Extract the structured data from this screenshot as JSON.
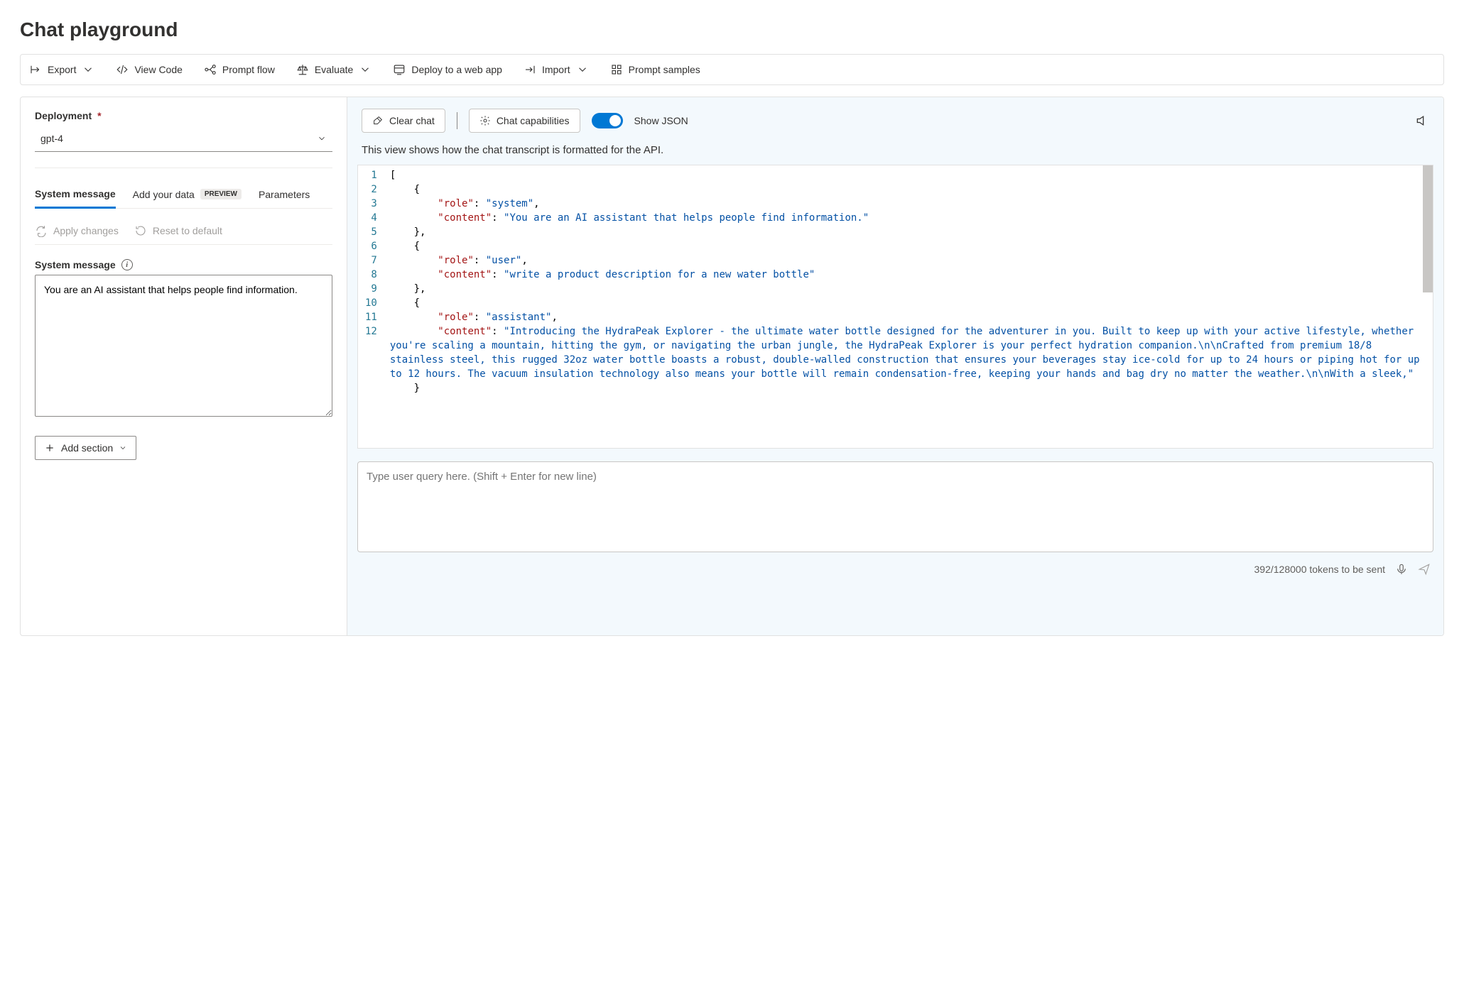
{
  "page_title": "Chat playground",
  "toolbar": {
    "export": "Export",
    "view_code": "View Code",
    "prompt_flow": "Prompt flow",
    "evaluate": "Evaluate",
    "deploy": "Deploy to a web app",
    "import": "Import",
    "samples": "Prompt samples"
  },
  "left": {
    "deployment_label": "Deployment",
    "deployment_value": "gpt-4",
    "tabs": {
      "system_message": "System message",
      "add_data": "Add your data",
      "add_data_badge": "PREVIEW",
      "parameters": "Parameters"
    },
    "apply_changes": "Apply changes",
    "reset_default": "Reset to default",
    "system_message_label": "System message",
    "system_message_value": "You are an AI assistant that helps people find information.",
    "add_section": "Add section"
  },
  "right_top": {
    "clear_chat": "Clear chat",
    "capabilities": "Chat capabilities",
    "show_json": "Show JSON"
  },
  "description": "This view shows how the chat transcript is formatted for the API.",
  "code_lines": [
    "1",
    "2",
    "3",
    "4",
    "5",
    "6",
    "7",
    "8",
    "9",
    "10",
    "11",
    "12"
  ],
  "json_transcript": [
    {
      "role": "system",
      "content": "You are an AI assistant that helps people find information."
    },
    {
      "role": "user",
      "content": "write a product description for a new water bottle"
    },
    {
      "role": "assistant",
      "content": "Introducing the HydraPeak Explorer - the ultimate water bottle designed for the adventurer in you. Built to keep up with your active lifestyle, whether you're scaling a mountain, hitting the gym, or navigating the urban jungle, the HydraPeak Explorer is your perfect hydration companion.\\n\\nCrafted from premium 18/8 stainless steel, this rugged 32oz water bottle boasts a robust, double-walled construction that ensures your beverages stay ice-cold for up to 24 hours or piping hot for up to 12 hours. The vacuum insulation technology also means your bottle will remain condensation-free, keeping your hands and bag dry no matter the weather.\\n\\nWith a sleek,"
    }
  ],
  "chat_input_placeholder": "Type user query here. (Shift + Enter for new line)",
  "footer": {
    "tokens": "392/128000 tokens to be sent"
  }
}
